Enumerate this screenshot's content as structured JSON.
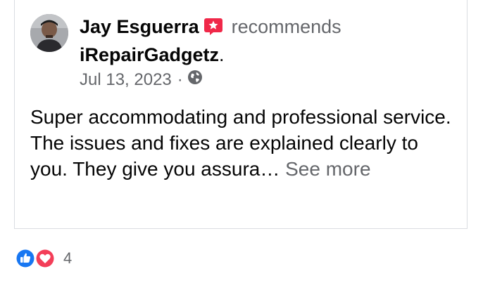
{
  "post": {
    "author_name": "Jay Esguerra",
    "verb": "recommends",
    "page_name": "iRepairGadgetz",
    "page_suffix": ".",
    "date": "Jul 13, 2023",
    "separator": "·",
    "privacy_icon": "globe-icon",
    "recommend_icon": "star-recommend-icon",
    "body_text": "Super accommodating and professional service. The issues and fixes are explained clearly to you. They give you assura…",
    "see_more_label": "See more"
  },
  "reactions": {
    "icons": [
      "like-icon",
      "love-icon"
    ],
    "count": "4"
  },
  "colors": {
    "like_blue": "#1877f2",
    "love_red": "#f33e58",
    "recommend_pink": "#f02849",
    "muted_text": "#65676b"
  }
}
